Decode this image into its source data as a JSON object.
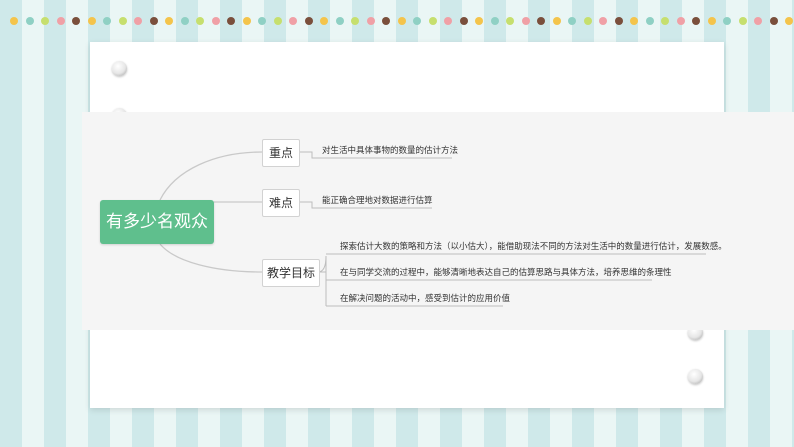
{
  "colors": {
    "root_bg": "#5fbf8d",
    "stripe_dark": "#cfe9ea",
    "stripe_light": "#eaf6f5",
    "dot_palette": [
      "#f4c44b",
      "#8fd0c4",
      "#c6df6e",
      "#f0a0a6",
      "#7a4f3c"
    ]
  },
  "mindmap": {
    "root": "有多少名观众",
    "branches": [
      {
        "label": "重点",
        "items": [
          "对生活中具体事物的数量的估计方法"
        ]
      },
      {
        "label": "难点",
        "items": [
          "能正确合理地对数据进行估算"
        ]
      },
      {
        "label": "教学目标",
        "items": [
          "探索估计大数的策略和方法（以小估大），能借助现法不同的方法对生活中的数量进行估计，发展数感。",
          "在与同学交流的过程中，能够清晰地表达自己的估算思路与具体方法，培养思维的条理性",
          "在解决问题的活动中，感受到估计的应用价值"
        ]
      }
    ]
  }
}
